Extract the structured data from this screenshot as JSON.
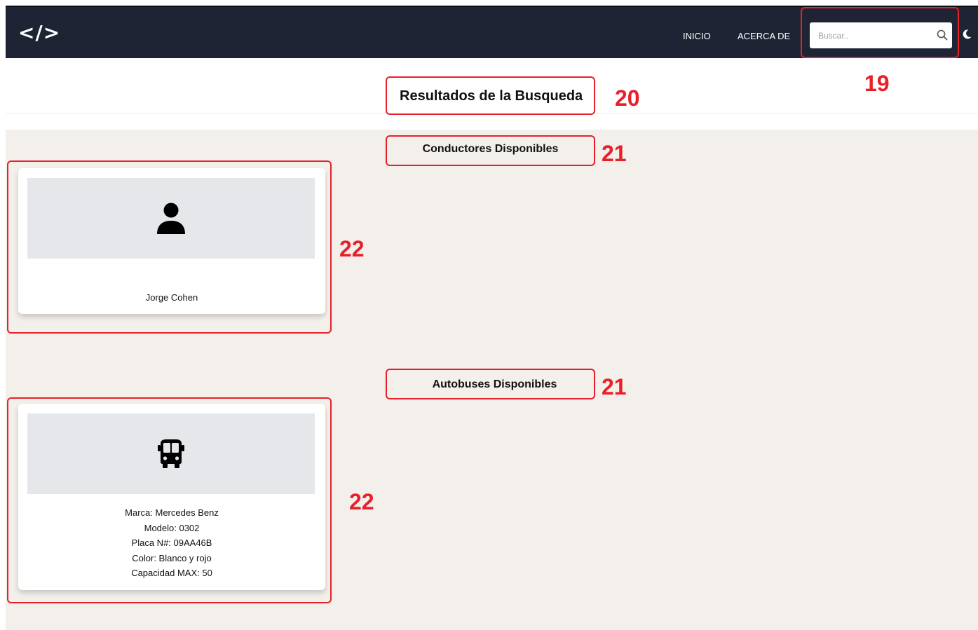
{
  "header": {
    "logo": "</>",
    "nav": [
      {
        "label": "INICIO"
      },
      {
        "label": "ACERCA DE"
      }
    ],
    "search": {
      "placeholder": "Buscar..",
      "value": "",
      "icon": "search-icon"
    },
    "theme_toggle_icon": "moon-icon"
  },
  "main": {
    "results_title": "Resultados de la Busqueda",
    "drivers": {
      "title": "Conductores Disponibles",
      "items": [
        {
          "icon": "person-icon",
          "name": "Jorge Cohen"
        }
      ]
    },
    "buses": {
      "title": "Autobuses Disponibles",
      "items": [
        {
          "icon": "bus-icon",
          "lines": [
            "Marca: Mercedes Benz",
            "Modelo: 0302",
            "Placa N#: 09AA46B",
            "Color: Blanco y rojo",
            "Capacidad MAX: 50"
          ]
        }
      ]
    }
  },
  "annotations": {
    "search": "19",
    "results_title": "20",
    "drivers_title": "21",
    "buses_title": "21",
    "driver_card": "22",
    "bus_card": "22",
    "color": "#e8202a"
  }
}
